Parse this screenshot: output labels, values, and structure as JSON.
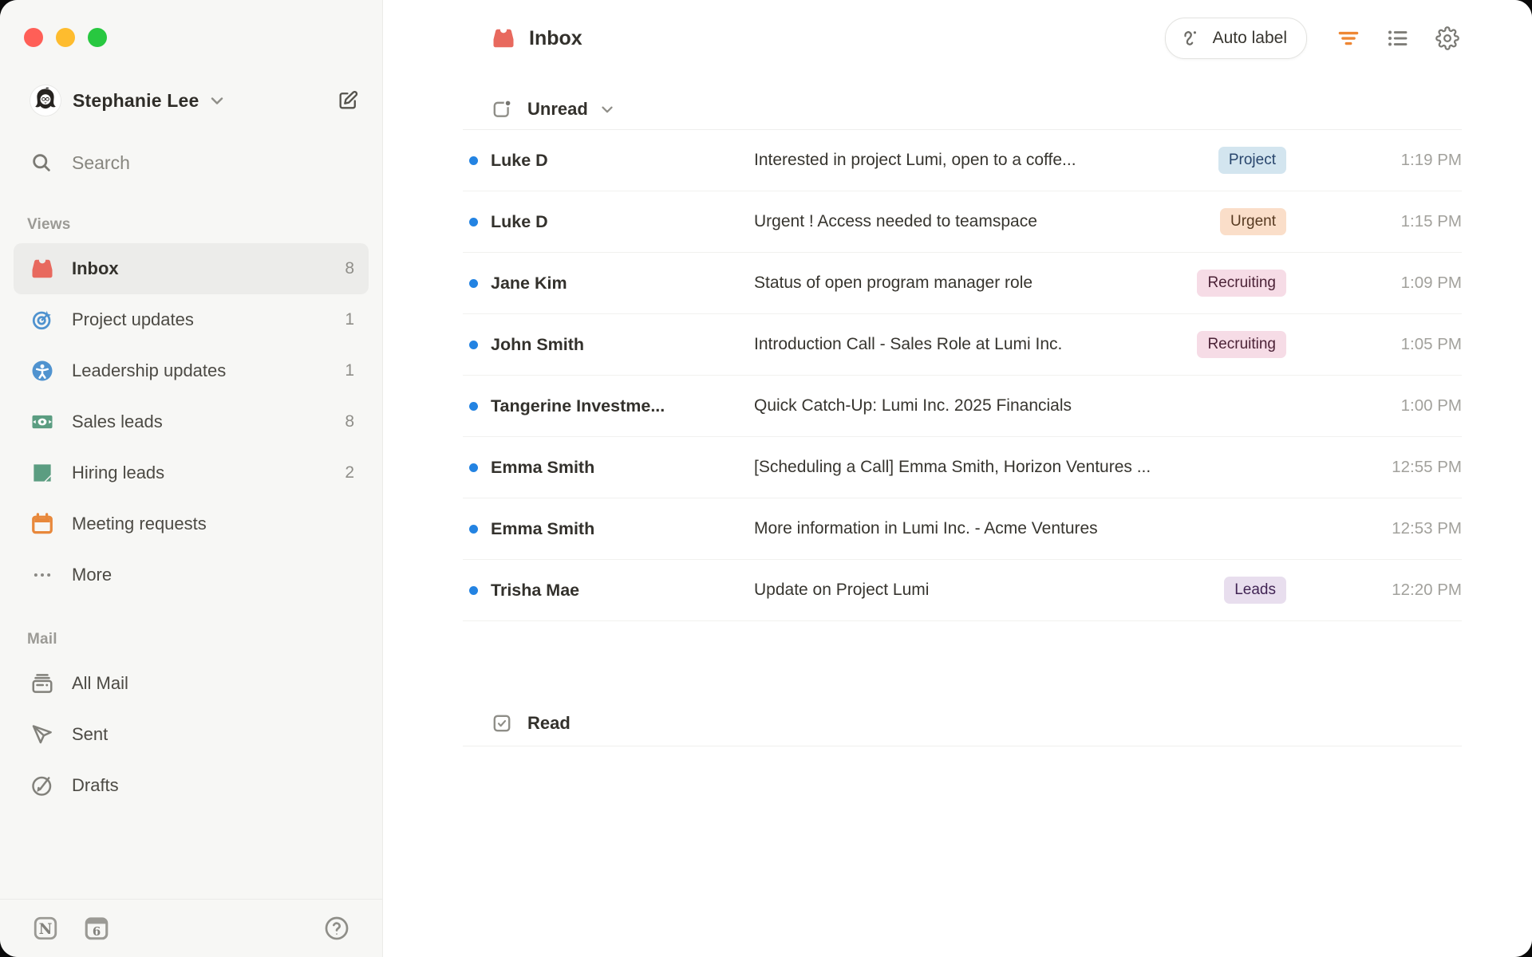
{
  "window": {
    "traffic_lights": {
      "close": "#ff5f57",
      "minimize": "#febc2e",
      "zoom": "#28c840"
    }
  },
  "sidebar": {
    "profile": {
      "name": "Stephanie Lee"
    },
    "search": {
      "label": "Search"
    },
    "views": {
      "section_label": "Views",
      "items": [
        {
          "label": "Inbox",
          "count": "8",
          "icon": "inbox-icon",
          "selected": true
        },
        {
          "label": "Project updates",
          "count": "1",
          "icon": "target-icon",
          "selected": false
        },
        {
          "label": "Leadership updates",
          "count": "1",
          "icon": "person-icon",
          "selected": false
        },
        {
          "label": "Sales leads",
          "count": "8",
          "icon": "money-icon",
          "selected": false
        },
        {
          "label": "Hiring leads",
          "count": "2",
          "icon": "note-icon",
          "selected": false
        },
        {
          "label": "Meeting requests",
          "count": "",
          "icon": "calendar-icon",
          "selected": false
        },
        {
          "label": "More",
          "count": "",
          "icon": "ellipsis-icon",
          "selected": false
        }
      ]
    },
    "mail": {
      "section_label": "Mail",
      "items": [
        {
          "label": "All Mail",
          "icon": "all-mail-icon"
        },
        {
          "label": "Sent",
          "icon": "sent-icon"
        },
        {
          "label": "Drafts",
          "icon": "drafts-icon"
        }
      ]
    }
  },
  "main": {
    "title": "Inbox",
    "auto_label_button": "Auto label",
    "sections": {
      "unread": "Unread",
      "read": "Read"
    },
    "emails": [
      {
        "sender": "Luke D",
        "subject": "Interested in project Lumi, open to a coffe...",
        "tag": "Project",
        "time": "1:19 PM"
      },
      {
        "sender": "Luke D",
        "subject": "Urgent ! Access needed to teamspace",
        "tag": "Urgent",
        "time": "1:15 PM"
      },
      {
        "sender": "Jane Kim",
        "subject": "Status of open program manager role",
        "tag": "Recruiting",
        "time": "1:09 PM"
      },
      {
        "sender": "John Smith",
        "subject": "Introduction Call - Sales Role at Lumi Inc.",
        "tag": "Recruiting",
        "time": "1:05 PM"
      },
      {
        "sender": "Tangerine Investme...",
        "subject": "Quick Catch-Up: Lumi Inc. 2025 Financials",
        "tag": "",
        "time": "1:00 PM"
      },
      {
        "sender": "Emma Smith",
        "subject": "[Scheduling a Call] Emma Smith, Horizon Ventures ...",
        "tag": "",
        "time": "12:55 PM"
      },
      {
        "sender": "Emma Smith",
        "subject": "More information in Lumi Inc. - Acme Ventures",
        "tag": "",
        "time": "12:53 PM"
      },
      {
        "sender": "Trisha Mae",
        "subject": "Update on Project Lumi",
        "tag": "Leads",
        "time": "12:20 PM"
      }
    ]
  },
  "colors": {
    "unread_dot": "#2383e2",
    "icon_red": "#e8695e",
    "icon_blue": "#5093cf",
    "icon_green": "#5b9d81",
    "icon_orange": "#e8883b",
    "filter_orange": "#ee8734",
    "tags": {
      "Project": {
        "bg": "#d3e5ef",
        "text": "#28456c"
      },
      "Urgent": {
        "bg": "#fadec9",
        "text": "#573a21"
      },
      "Recruiting": {
        "bg": "#f6dce6",
        "text": "#4c2337"
      },
      "Leads": {
        "bg": "#e8deee",
        "text": "#412454"
      }
    }
  }
}
